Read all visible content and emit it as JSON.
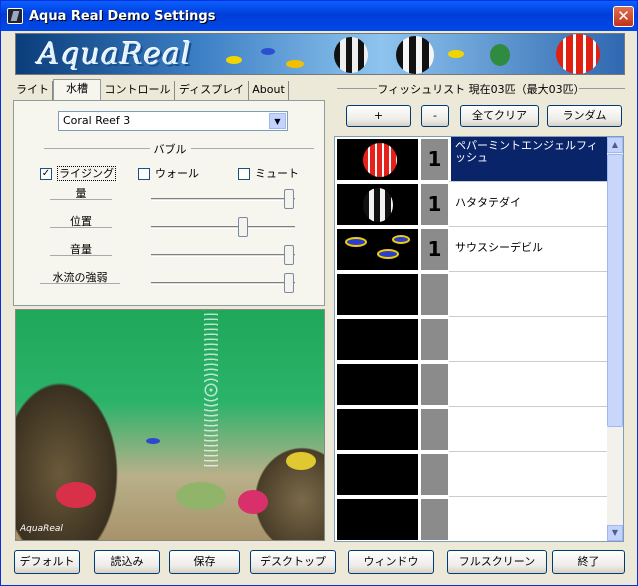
{
  "window": {
    "title": "Aqua Real Demo Settings",
    "close_icon": "close-icon"
  },
  "banner": {
    "logo_text": "AquaReal"
  },
  "tabs": [
    {
      "label": "ライト"
    },
    {
      "label": "水槽"
    },
    {
      "label": "コントロール"
    },
    {
      "label": "ディスプレイ"
    },
    {
      "label": "About"
    }
  ],
  "active_tab": 1,
  "tank": {
    "selected": "Coral Reef 3"
  },
  "bubble": {
    "group_label": "バブル",
    "checkboxes": [
      {
        "label": "ライジング",
        "checked": true
      },
      {
        "label": "ウォール",
        "checked": false
      },
      {
        "label": "ミュート",
        "checked": false
      }
    ],
    "sliders": [
      {
        "label": "量",
        "value": 1.0
      },
      {
        "label": "位置",
        "value": 0.65
      },
      {
        "label": "音量",
        "value": 1.0
      },
      {
        "label": "水流の強弱",
        "value": 1.0
      }
    ]
  },
  "fishlist": {
    "title": "フィッシュリスト 現在03匹（最大03匹）",
    "buttons": {
      "add": "+",
      "remove": "-",
      "clear": "全てクリア",
      "random": "ランダム"
    },
    "rows": [
      {
        "count": "1",
        "name": "ペパーミントエンジェルフィッシュ",
        "selected": true,
        "fish": "peppermint"
      },
      {
        "count": "1",
        "name": "ハタタテダイ",
        "selected": false,
        "fish": "bannerfish"
      },
      {
        "count": "1",
        "name": "サウスシーデビル",
        "selected": false,
        "fish": "devil"
      },
      {
        "count": "",
        "name": ""
      },
      {
        "count": "",
        "name": ""
      },
      {
        "count": "",
        "name": ""
      },
      {
        "count": "",
        "name": ""
      },
      {
        "count": "",
        "name": ""
      },
      {
        "count": "",
        "name": ""
      }
    ]
  },
  "bottom": {
    "default": "デフォルト",
    "load": "読込み",
    "save": "保存",
    "desktop": "デスクトップ",
    "window": "ウィンドウ",
    "fullscreen": "フルスクリーン",
    "exit": "終了"
  },
  "preview": {
    "logo": "AquaReal"
  }
}
